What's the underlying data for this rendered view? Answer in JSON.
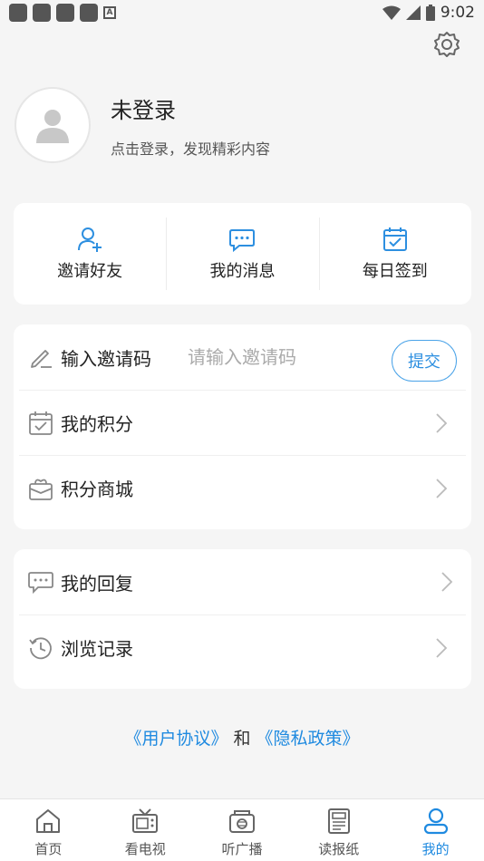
{
  "status_bar": {
    "time": "9:02"
  },
  "profile": {
    "title": "未登录",
    "subtitle": "点击登录，发现精彩内容"
  },
  "quick_actions": [
    {
      "label": "邀请好友",
      "icon": "add-user-icon"
    },
    {
      "label": "我的消息",
      "icon": "message-icon"
    },
    {
      "label": "每日签到",
      "icon": "calendar-check-icon"
    }
  ],
  "invite": {
    "label": "输入邀请码",
    "placeholder": "请输入邀请码",
    "submit": "提交"
  },
  "menu_group1": [
    {
      "label": "我的积分",
      "icon": "points-calendar-icon"
    },
    {
      "label": "积分商城",
      "icon": "gift-box-icon"
    }
  ],
  "menu_group2": [
    {
      "label": "我的回复",
      "icon": "reply-icon"
    },
    {
      "label": "浏览记录",
      "icon": "history-icon"
    }
  ],
  "policy": {
    "user_agreement": "《用户协议》",
    "and": "和",
    "privacy_policy": "《隐私政策》"
  },
  "tabs": [
    {
      "label": "首页",
      "icon": "home-icon"
    },
    {
      "label": "看电视",
      "icon": "tv-icon"
    },
    {
      "label": "听广播",
      "icon": "radio-icon"
    },
    {
      "label": "读报纸",
      "icon": "newspaper-icon"
    },
    {
      "label": "我的",
      "icon": "user-icon",
      "active": true
    }
  ],
  "colors": {
    "accent": "#1f8ae0",
    "background": "#f5f5f5"
  }
}
